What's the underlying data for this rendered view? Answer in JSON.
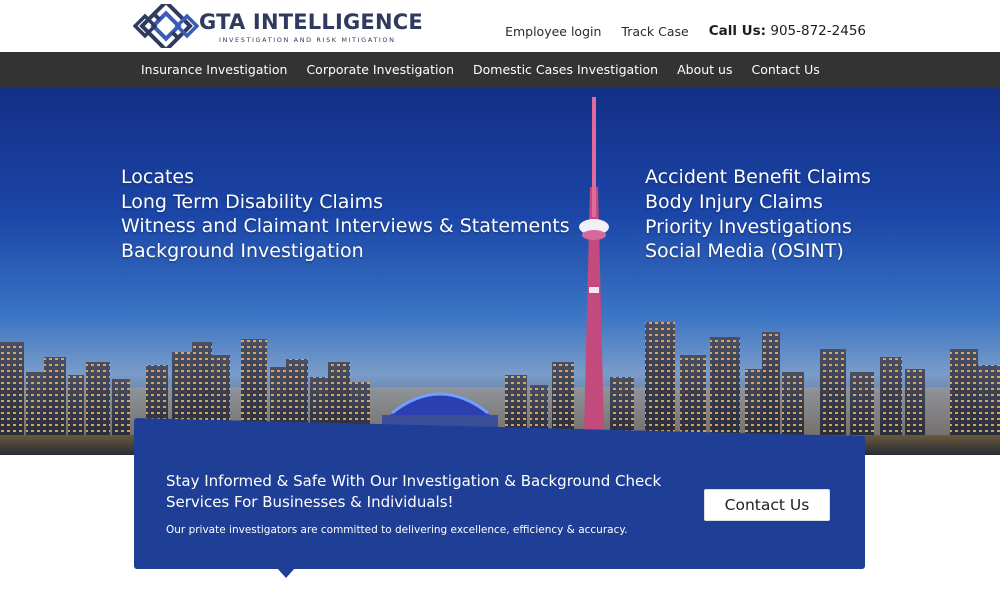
{
  "brand": {
    "name": "GTA INTELLIGENCE",
    "tagline": "INVESTIGATION AND RISK MITIGATION",
    "logo_icon": "diamond-grid-logo-icon",
    "primary_color": "#2f3a5e"
  },
  "top_bar": {
    "employee_login": "Employee login",
    "track_case": "Track Case",
    "call_label": "Call Us:",
    "phone": "905-872-2456"
  },
  "nav": {
    "items": [
      {
        "label": "Insurance Investigation"
      },
      {
        "label": "Corporate Investigation"
      },
      {
        "label": "Domestic Cases Investigation"
      },
      {
        "label": "About us"
      },
      {
        "label": "Contact Us"
      }
    ],
    "background": "#333333"
  },
  "hero": {
    "services_left": [
      "Locates",
      "Long Term Disability Claims",
      "Witness and Claimant Interviews & Statements",
      "Background Investigation"
    ],
    "services_right": [
      "Accident Benefit Claims",
      "Body Injury Claims",
      "Priority Investigations",
      "Social Media (OSINT)"
    ]
  },
  "cta": {
    "heading": "Stay Informed & Safe With Our Investigation & Background Check Services For Businesses & Individuals!",
    "subtext": "Our private investigators are committed to delivering excellence, efficiency & accuracy.",
    "button_label": "Contact Us",
    "background": "#1f3f96"
  }
}
